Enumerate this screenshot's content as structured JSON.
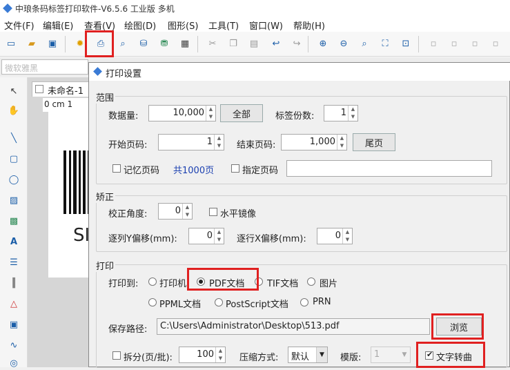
{
  "app": {
    "title": "中琅条码标签打印软件-V6.5.6 工业版 多机"
  },
  "menu": [
    "文件(F)",
    "编辑(E)",
    "查看(V)",
    "绘图(D)",
    "图形(S)",
    "工具(T)",
    "窗口(W)",
    "帮助(H)"
  ],
  "fontbar": {
    "font": "微软雅黑"
  },
  "doc": {
    "tab": "未命名-1",
    "ruler": "0 cm 1",
    "sample_text": "SI"
  },
  "dialog": {
    "title": "打印设置",
    "range": {
      "group": "范围",
      "quantity_label": "数据量:",
      "quantity": "10,000",
      "all_button": "全部",
      "copies_label": "标签份数:",
      "copies": "1",
      "start_label": "开始页码:",
      "start": "1",
      "end_label": "结束页码:",
      "end": "1,000",
      "last_button": "尾页",
      "remember_label": "记忆页码",
      "total": "共1000页",
      "specify_label": "指定页码"
    },
    "correction": {
      "group": "矫正",
      "angle_label": "校正角度:",
      "angle": "0",
      "mirror_label": "水平镜像",
      "yoffset_label": "逐列Y偏移(mm):",
      "yoffset": "0",
      "xoffset_label": "逐行X偏移(mm):",
      "xoffset": "0"
    },
    "print": {
      "group": "打印",
      "to_label": "打印到:",
      "opt_printer": "打印机",
      "opt_pdf": "PDF文档",
      "opt_tif": "TIF文档",
      "opt_image": "图片",
      "opt_ppml": "PPML文档",
      "opt_ps": "PostScript文档",
      "opt_prn": "PRN",
      "path_label": "保存路径:",
      "path": "C:\\Users\\Administrator\\Desktop\\513.pdf",
      "browse_button": "浏览",
      "split_label": "拆分(页/批):",
      "split": "100",
      "compress_label": "压缩方式:",
      "compress": "默认",
      "template_label": "模版:",
      "template": "1",
      "text_to_curve_label": "文字转曲"
    }
  }
}
